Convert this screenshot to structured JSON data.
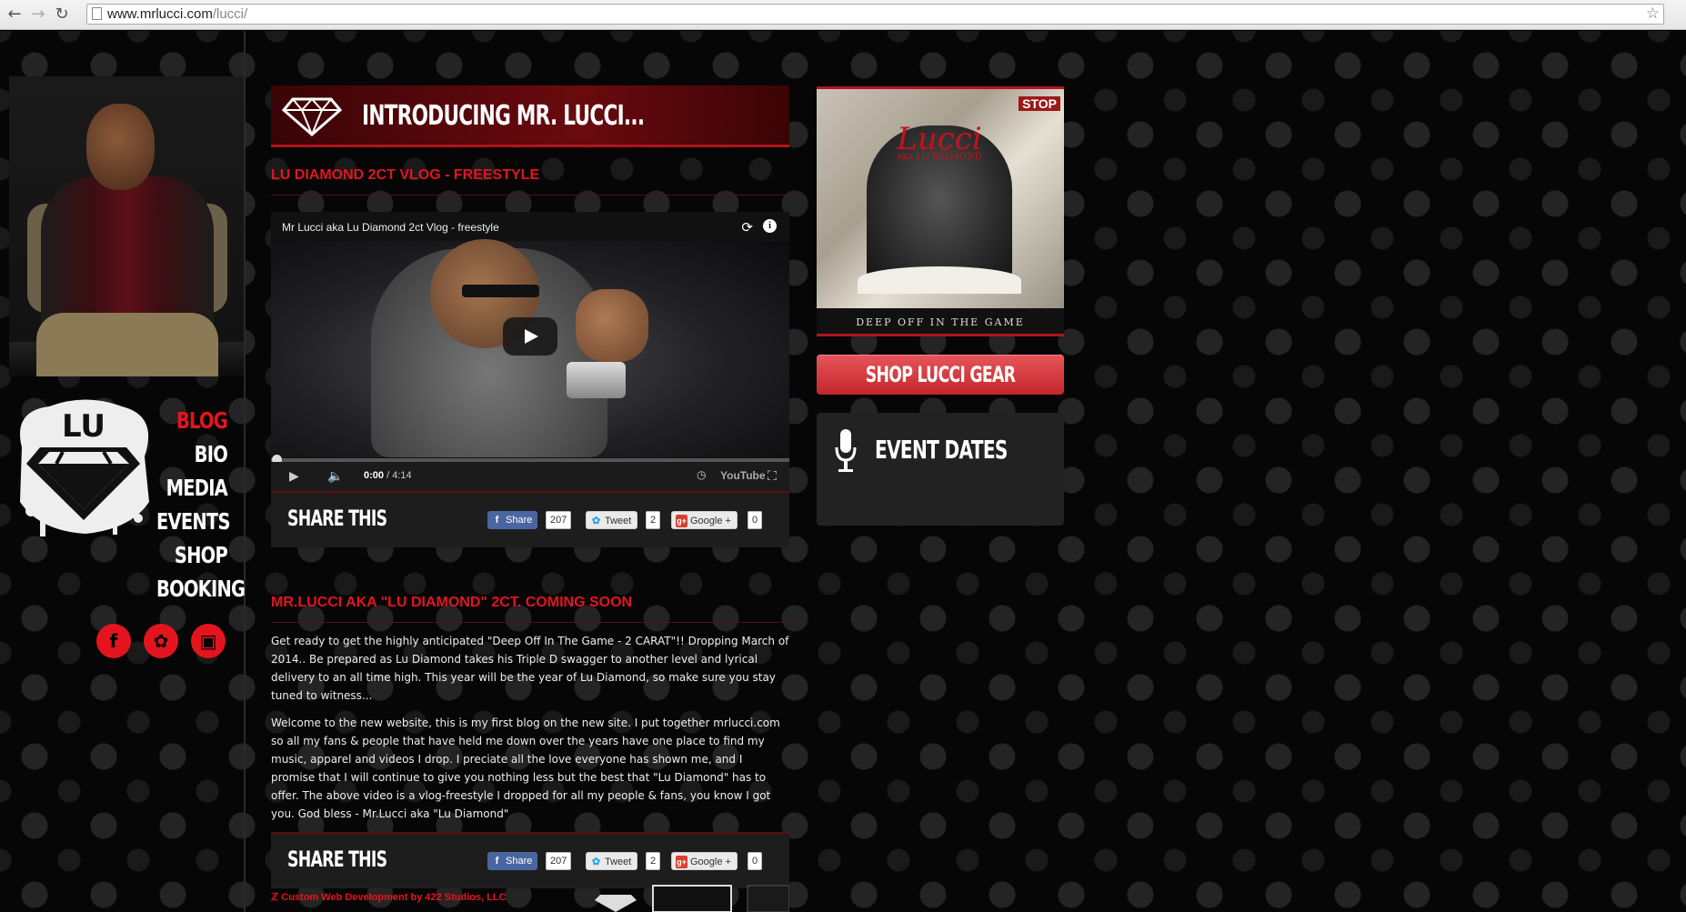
{
  "browser": {
    "url_host": "www.mrlucci.com",
    "url_path": "/lucci/"
  },
  "sidebar": {
    "logo_text": "LU",
    "menu": [
      {
        "label": "BLOG",
        "active": true
      },
      {
        "label": "BIO",
        "active": false
      },
      {
        "label": "MEDIA",
        "active": false
      },
      {
        "label": "EVENTS",
        "active": false
      },
      {
        "label": "SHOP",
        "active": false
      },
      {
        "label": "BOOKING",
        "active": false
      }
    ],
    "socials": [
      "facebook-icon",
      "twitter-icon",
      "instagram-icon"
    ]
  },
  "main": {
    "page_title": "INTRODUCING MR. LUCCI...",
    "posts": [
      {
        "title": "LU DIAMOND 2CT VLOG - FREESTYLE",
        "video": {
          "title": "Mr Lucci aka Lu Diamond 2ct Vlog - freestyle",
          "current_time": "0:00",
          "duration": "/ 4:14",
          "brand": "YouTube"
        },
        "share": {
          "label": "SHARE THIS",
          "fb_label": "Share",
          "fb_count": "207",
          "tw_label": "Tweet",
          "tw_count": "2",
          "gp_label": "Google +",
          "gp_count": "0"
        }
      },
      {
        "title": "MR.LUCCI AKA \"LU DIAMOND\" 2CT. COMING SOON",
        "paragraphs": [
          "Get ready to get the highly anticipated \"Deep Off In The Game - 2 CARAT\"!! Dropping March of 2014.. Be prepared as Lu Diamond takes his Triple D swagger to another level and lyrical delivery to an all time high. This year will be the year of Lu Diamond, so make sure you stay tuned to witness...",
          "Welcome to the new website, this is my first blog on the new site. I put together mrlucci.com so all my fans & people that have held me down over the years have one place to find my music, apparel and videos I drop. I preciate all the love everyone has shown me, and I promise that I will continue to give you nothing less but the best that \"Lu Diamond\" has to offer. The above video is a vlog-freestyle I dropped for all my people & fans, you know I got you. God bless - Mr.Lucci aka \"Lu Diamond\""
        ],
        "share": {
          "label": "SHARE THIS",
          "fb_label": "Share",
          "fb_count": "207",
          "tw_label": "Tweet",
          "tw_count": "2",
          "gp_label": "Google +",
          "gp_count": "0"
        }
      }
    ],
    "footer_credit": "Custom Web Development by 422 Studios, LLC"
  },
  "right": {
    "album": {
      "title": "Lucci",
      "subtitle": "aka LU DIAMOND",
      "stop_sign": "STOP",
      "tagline": "DEEP OFF IN THE GAME"
    },
    "shop_button": "SHOP LUCCI GEAR",
    "events_title": "EVENT DATES"
  },
  "colors": {
    "accent": "#e4141f",
    "title_bar": "#6a0a0e",
    "panel": "#1d1d1d"
  }
}
